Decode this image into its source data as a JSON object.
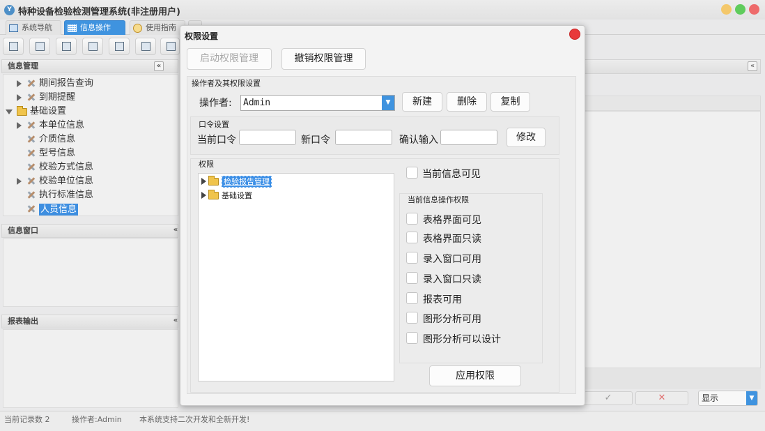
{
  "app": {
    "title": "特种设备检验检测管理系统(非注册用户)",
    "icon_letter": "Y"
  },
  "tabs": [
    {
      "label": "系统导航",
      "active": false
    },
    {
      "label": "信息操作",
      "active": true
    },
    {
      "label": "使用指南",
      "active": false
    }
  ],
  "left_panel": {
    "info_manage": {
      "title": "信息管理",
      "collapse": "«",
      "tree": [
        {
          "label": "期间报告查询",
          "level": 1,
          "expander": "collapsed",
          "icon": "tool-icon"
        },
        {
          "label": "到期提醒",
          "level": 1,
          "expander": "collapsed",
          "icon": "tool-icon"
        },
        {
          "label": "基础设置",
          "level": 0,
          "expander": "expanded",
          "icon": "folder-icon"
        },
        {
          "label": "本单位信息",
          "level": 1,
          "expander": "collapsed",
          "icon": "tool-icon"
        },
        {
          "label": "介质信息",
          "level": 1,
          "expander": "none",
          "icon": "tool-icon"
        },
        {
          "label": "型号信息",
          "level": 1,
          "expander": "none",
          "icon": "tool-icon"
        },
        {
          "label": "校验方式信息",
          "level": 1,
          "expander": "none",
          "icon": "tool-icon"
        },
        {
          "label": "校验单位信息",
          "level": 1,
          "expander": "collapsed",
          "icon": "tool-icon"
        },
        {
          "label": "执行标准信息",
          "level": 1,
          "expander": "none",
          "icon": "tool-icon"
        },
        {
          "label": "人员信息",
          "level": 1,
          "expander": "none",
          "icon": "tool-icon",
          "selected": true
        }
      ]
    },
    "info_window": {
      "title": "信息窗口",
      "collapse": "«"
    },
    "report_output": {
      "title": "报表输出",
      "collapse": "«"
    }
  },
  "right_panel": {
    "collapse": "«",
    "ok_symbol": "✓",
    "cancel_symbol": "✕",
    "display_select": "显示"
  },
  "status_bar": {
    "record_count": "当前记录数 2",
    "operator": "操作者:Admin",
    "note": "本系统支持二次开发和全新开发!"
  },
  "dialog": {
    "title": "权限设置",
    "start_btn": "启动权限管理",
    "revoke_btn": "撤销权限管理",
    "operator_group": {
      "title": "操作者及其权限设置",
      "operator_label": "操作者:",
      "operator_value": "Admin",
      "new_btn": "新建",
      "delete_btn": "删除",
      "copy_btn": "复制"
    },
    "password_group": {
      "title": "口令设置",
      "current_label": "当前口令",
      "new_label": "新口令",
      "confirm_label": "确认输入",
      "current_value": "",
      "new_value": "",
      "confirm_value": "",
      "modify_btn": "修改"
    },
    "permission_group": {
      "title": "权限",
      "tree": [
        {
          "label": "检验报告管理",
          "selected": true
        },
        {
          "label": "基础设置",
          "selected": false
        }
      ],
      "visible_checkbox": {
        "label": "当前信息可见",
        "checked": false
      },
      "ops_group": {
        "title": "当前信息操作权限",
        "checkboxes": [
          {
            "label": "表格界面可见",
            "checked": false
          },
          {
            "label": "表格界面只读",
            "checked": false
          },
          {
            "label": "录入窗口可用",
            "checked": false
          },
          {
            "label": "录入窗口只读",
            "checked": false
          },
          {
            "label": "报表可用",
            "checked": false
          },
          {
            "label": "图形分析可用",
            "checked": false
          },
          {
            "label": "图形分析可以设计",
            "checked": false
          }
        ]
      },
      "apply_btn": "应用权限"
    }
  }
}
